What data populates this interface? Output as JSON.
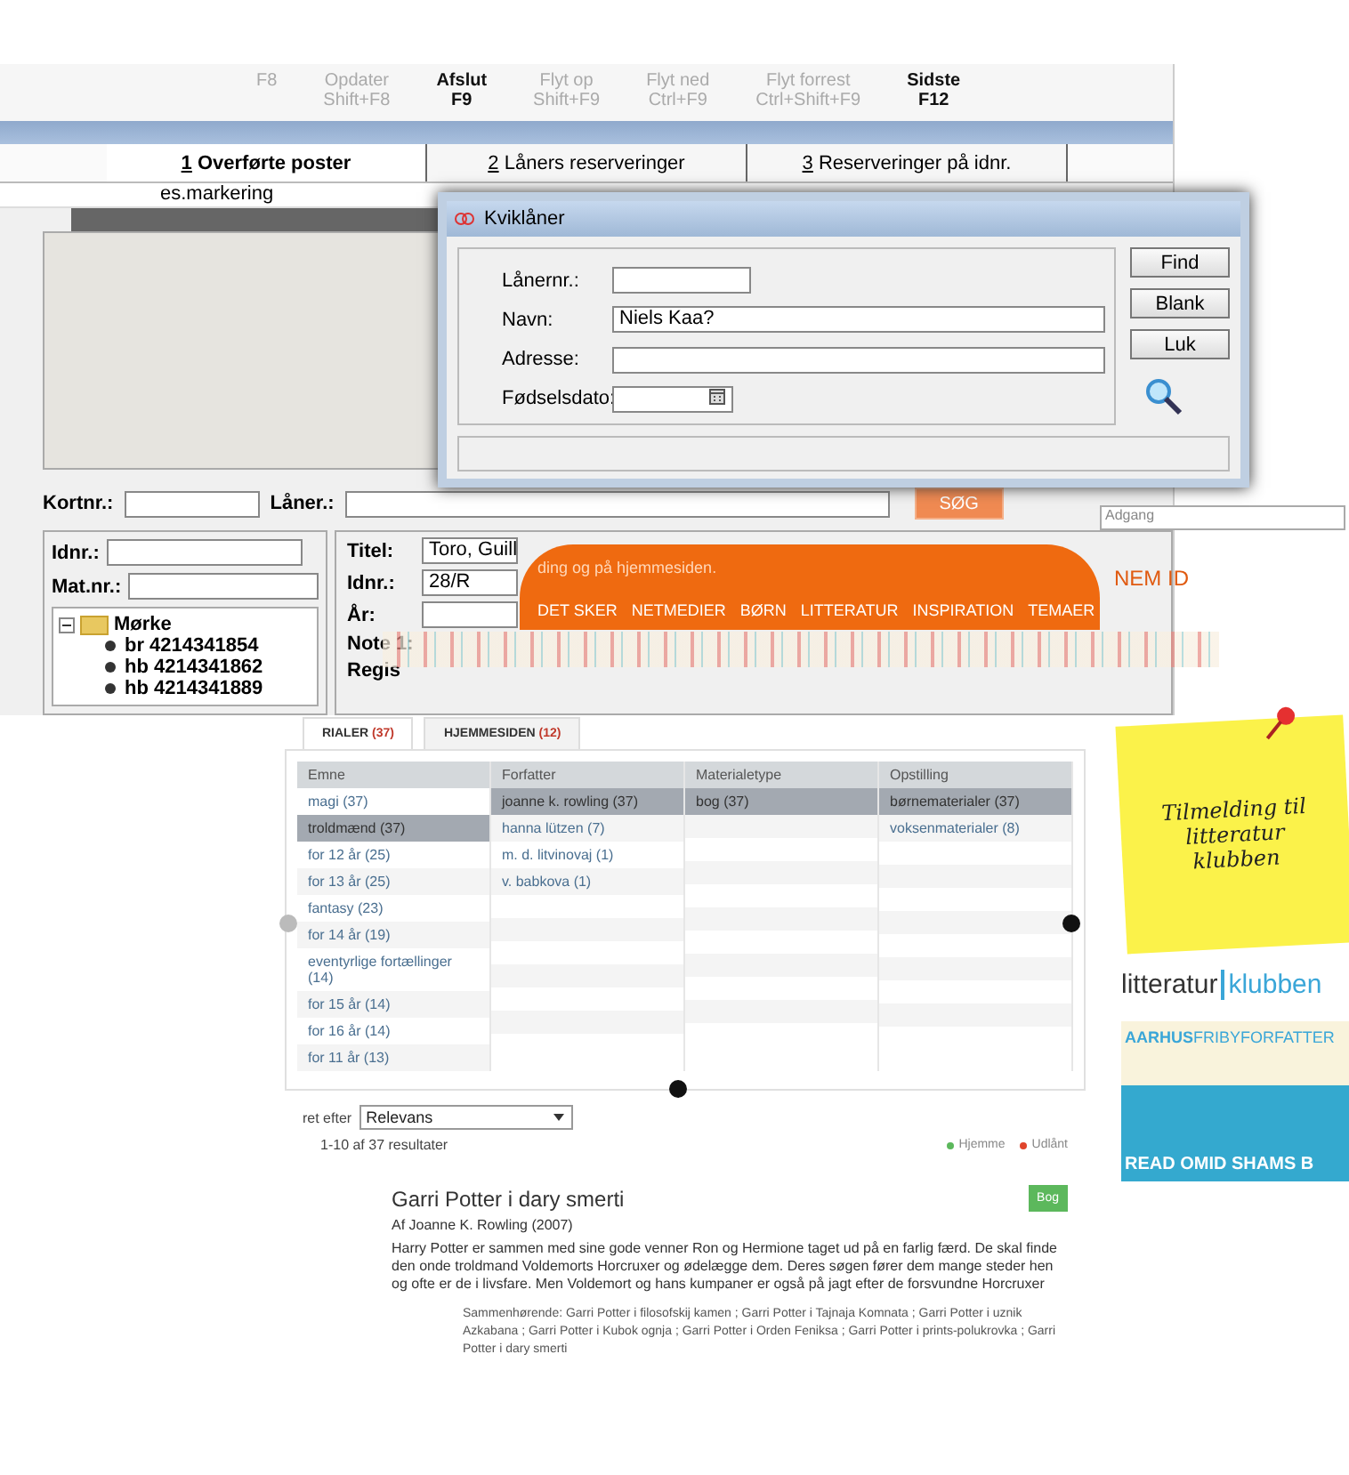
{
  "app": {
    "toolbar": [
      {
        "key": "F8",
        "disabled": true
      },
      {
        "label": "Opdater",
        "key": "Shift+F8",
        "disabled": true
      },
      {
        "label": "Afslut",
        "key": "F9",
        "disabled": false
      },
      {
        "label": "Flyt op",
        "key": "Shift+F9",
        "disabled": true
      },
      {
        "label": "Flyt ned",
        "key": "Ctrl+F9",
        "disabled": true
      },
      {
        "label": "Flyt forrest",
        "key": "Ctrl+Shift+F9",
        "disabled": true
      },
      {
        "label": "Sidste",
        "key": "F12",
        "disabled": false
      }
    ],
    "tabs": [
      {
        "number": "1",
        "label": "Overførte poster",
        "selected": true
      },
      {
        "number": "2",
        "label": "Låners reserveringer",
        "selected": false
      },
      {
        "number": "3",
        "label": "Reserveringer på idnr.",
        "selected": false
      }
    ],
    "list_header": "es.markering",
    "search": {
      "fields": [
        "Kortnr.:",
        "Låner.:"
      ],
      "button": "SØG"
    },
    "left_fields": [
      "Idnr.:",
      "Mat.nr.:"
    ],
    "tree": {
      "label": "Mørke",
      "expanded": true,
      "children": [
        {
          "label": "br 4214341854"
        },
        {
          "label": "hb 4214341862"
        },
        {
          "label": "hb 4214341889"
        }
      ]
    },
    "form": [
      {
        "kind": "field",
        "label": "Titel:",
        "value": "Toro, Guill"
      },
      {
        "kind": "field",
        "label": "Idnr.:",
        "value": "28/R"
      },
      {
        "kind": "field",
        "label": "År:"
      },
      {
        "kind": "plain",
        "label": "Note 1:"
      },
      {
        "kind": "plain",
        "label": "Regis"
      }
    ]
  },
  "dialog": {
    "title": "Kviklåner",
    "fields": [
      {
        "label": "Lånernr.:",
        "kind": "short"
      },
      {
        "label": "Navn:",
        "kind": "long",
        "value": "Niels Kaa?"
      },
      {
        "label": "Adresse:",
        "kind": "long"
      },
      {
        "label": "Fødselsdato:",
        "kind": "date"
      }
    ],
    "buttons": [
      "Find",
      "Blank",
      "Luk"
    ]
  },
  "web": {
    "intro": "ding og på hjemmesiden.",
    "nav": [
      "DET SKER",
      "NETMEDIER",
      "BØRN",
      "LITTERATUR",
      "INSPIRATION",
      "TEMAER"
    ],
    "nem_id": "NEM ID",
    "access": "Adgang",
    "tabs": [
      {
        "label": "RIALER",
        "count": "(37)",
        "selected": true
      },
      {
        "label": "HJEMMESIDEN",
        "count": "(12)",
        "selected": false
      }
    ],
    "facets": [
      {
        "heading": "Emne",
        "items": [
          {
            "label": "magi (37)",
            "selected": false
          },
          {
            "label": "troldmænd (37)",
            "selected": true
          },
          {
            "label": "for 12 år (25)",
            "selected": false
          },
          {
            "label": "for 13 år (25)",
            "selected": false
          },
          {
            "label": "fantasy (23)",
            "selected": false
          },
          {
            "label": "for 14 år (19)",
            "selected": false
          },
          {
            "label": "eventyrlige fortællinger (14)",
            "selected": false
          },
          {
            "label": "for 15 år (14)",
            "selected": false
          },
          {
            "label": "for 16 år (14)",
            "selected": false
          },
          {
            "label": "for 11 år (13)",
            "selected": false
          }
        ]
      },
      {
        "heading": "Forfatter",
        "items": [
          {
            "label": "joanne k. rowling (37)",
            "selected": true
          },
          {
            "label": "hanna lützen (7)",
            "selected": false
          },
          {
            "label": "m. d. litvinovaj (1)",
            "selected": false
          },
          {
            "label": "v. babkova (1)",
            "selected": false
          }
        ]
      },
      {
        "heading": "Materialetype",
        "items": [
          {
            "label": "bog (37)",
            "selected": true
          }
        ]
      },
      {
        "heading": "Opstilling",
        "items": [
          {
            "label": "børnematerialer (37)",
            "selected": true
          },
          {
            "label": "voksenmaterialer (8)",
            "selected": false
          }
        ]
      }
    ],
    "sort": {
      "label": "ret efter",
      "value": "Relevans"
    },
    "results_count": "1-10 af 37 resultater",
    "legend": [
      {
        "label": "Hjemme",
        "color": "#5cb85c"
      },
      {
        "label": "Udlånt",
        "color": "#e0452c"
      }
    ],
    "result": {
      "title": "Garri Potter i dary smerti",
      "type": "Bog",
      "byline": "Af Joanne K. Rowling (2007)",
      "description": "Harry Potter er sammen med sine gode venner Ron og Hermione taget ud på en farlig færd. De skal finde den onde troldmand Voldemorts Horcruxer og ødelægge dem. Deres søgen fører dem mange steder hen og ofte er de i livsfare. Men Voldemort og hans kumpaner er også på jagt efter de forsvundne Horcruxer",
      "related": "Sammenhørende: Garri Potter i filosofskij kamen ; Garri Potter i Tajnaja Komnata ; Garri Potter i uznik Azkabana ; Garri Potter i Kubok ognja ; Garri Potter i Orden Feniksa ; Garri Potter i prints-polukrovka ; Garri Potter i dary smerti"
    },
    "sidebar": {
      "note": "Tilmelding til litteratur klubben",
      "logo": [
        "litteratur",
        "klubben"
      ],
      "banner": {
        "bold": "AARHUS",
        "rest": "FRIBYFORFATTER",
        "caption": "READ OMID SHAMS B"
      }
    }
  }
}
